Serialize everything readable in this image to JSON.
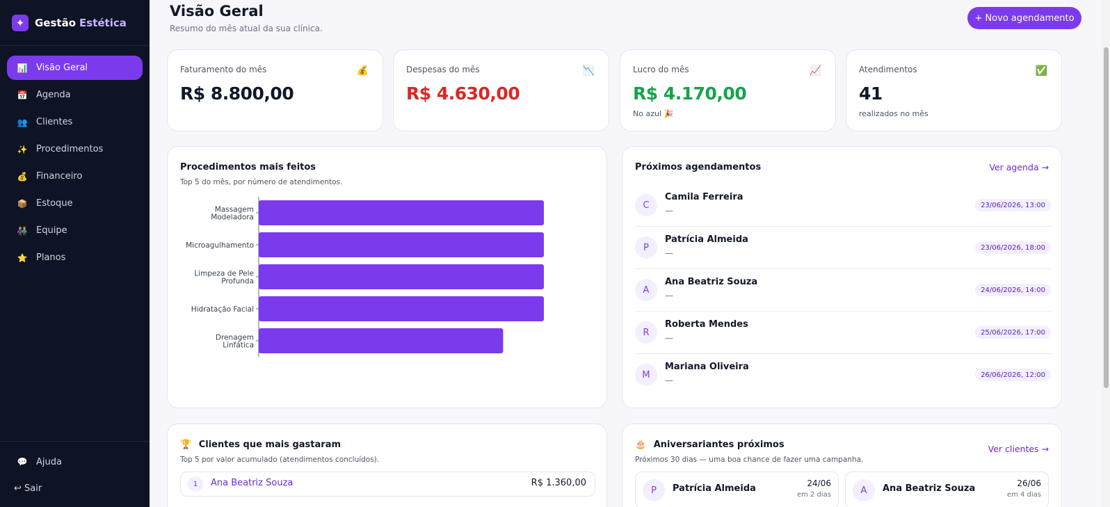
{
  "brand": {
    "logo": "✦",
    "name": "Gestão",
    "accent": "Estética"
  },
  "nav": [
    {
      "icon": "📊",
      "label": "Visão Geral"
    },
    {
      "icon": "📅",
      "label": "Agenda"
    },
    {
      "icon": "👥",
      "label": "Clientes"
    },
    {
      "icon": "✨",
      "label": "Procedimentos"
    },
    {
      "icon": "💰",
      "label": "Financeiro"
    },
    {
      "icon": "📦",
      "label": "Estoque"
    },
    {
      "icon": "👫",
      "label": "Equipe"
    },
    {
      "icon": "⭐",
      "label": "Planos"
    }
  ],
  "sidebar_bottom": {
    "help_icon": "💬",
    "help": "Ajuda",
    "logout": "↩ Sair"
  },
  "header": {
    "title": "Visão Geral",
    "subtitle": "Resumo do mês atual da sua clínica.",
    "new_button": "+ Novo agendamento"
  },
  "stats": [
    {
      "label": "Faturamento do mês",
      "icon": "💰",
      "value": "R$ 8.800,00",
      "color": "#111827",
      "note": ""
    },
    {
      "label": "Despesas do mês",
      "icon": "📉",
      "value": "R$ 4.630,00",
      "color": "#dc2626",
      "note": ""
    },
    {
      "label": "Lucro do mês",
      "icon": "📈",
      "value": "R$ 4.170,00",
      "color": "#16a34a",
      "note": "No azul 🎉"
    },
    {
      "label": "Atendimentos",
      "icon": "✅",
      "value": "41",
      "color": "#111827",
      "note": "realizados no mês"
    }
  ],
  "procedures_card": {
    "title": "Procedimentos mais feitos",
    "subtitle": "Top 5 do mês, por número de atendimentos."
  },
  "chart_data": {
    "type": "bar",
    "orientation": "horizontal",
    "categories": [
      "Massagem Modeladora",
      "Microagulhamento",
      "Limpeza de Pele Profunda",
      "Hidratação Facial",
      "Drenagem Linfática"
    ],
    "category_lines": [
      [
        "Massagem",
        "Modeladora"
      ],
      [
        "Microagulhamento"
      ],
      [
        "Limpeza de Pele",
        "Profunda"
      ],
      [
        "Hidratação Facial"
      ],
      [
        "Drenagem",
        "Linfática"
      ]
    ],
    "values": [
      7,
      7,
      7,
      7,
      6
    ],
    "xlim": [
      0,
      7
    ],
    "color": "#7c3aed",
    "grid": false,
    "title": "",
    "xlabel": "",
    "ylabel": ""
  },
  "appointments": {
    "title": "Próximos agendamentos",
    "link": "Ver agenda →",
    "items": [
      {
        "initial": "C",
        "name": "Camila Ferreira",
        "procedure": "—",
        "date": "23/06/2026, 13:00"
      },
      {
        "initial": "P",
        "name": "Patrícia Almeida",
        "procedure": "—",
        "date": "23/06/2026, 18:00"
      },
      {
        "initial": "A",
        "name": "Ana Beatriz Souza",
        "procedure": "—",
        "date": "24/06/2026, 14:00"
      },
      {
        "initial": "R",
        "name": "Roberta Mendes",
        "procedure": "—",
        "date": "25/06/2026, 17:00"
      },
      {
        "initial": "M",
        "name": "Mariana Oliveira",
        "procedure": "—",
        "date": "26/06/2026, 12:00"
      }
    ]
  },
  "top_clients": {
    "icon": "🏆",
    "title": "Clientes que mais gastaram",
    "subtitle": "Top 5 por valor acumulado (atendimentos concluídos).",
    "items": [
      {
        "rank": "1",
        "name": "Ana Beatriz Souza",
        "total": "R$ 1.360,00"
      }
    ]
  },
  "birthdays": {
    "icon": "🎂",
    "title": "Aniversariantes próximos",
    "subtitle": "Próximos 30 dias — uma boa chance de fazer uma campanha.",
    "link": "Ver clientes →",
    "items": [
      {
        "initial": "P",
        "name": "Patrícia Almeida",
        "date": "24/06",
        "relative": "em 2 dias"
      },
      {
        "initial": "A",
        "name": "Ana Beatriz Souza",
        "date": "26/06",
        "relative": "em 4 dias"
      }
    ]
  }
}
